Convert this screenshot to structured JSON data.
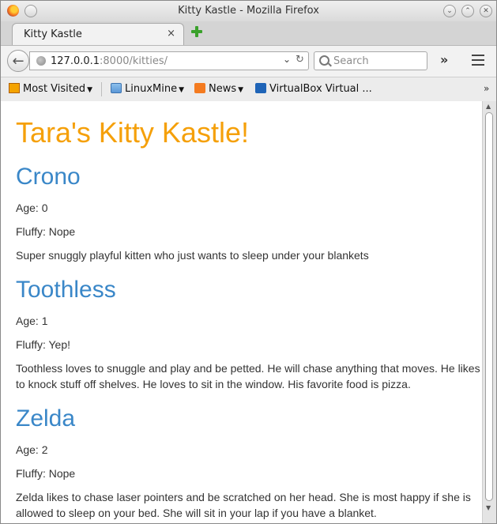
{
  "window": {
    "title": "Kitty Kastle - Mozilla Firefox"
  },
  "tab": {
    "label": "Kitty Kastle",
    "close_glyph": "×"
  },
  "navbar": {
    "url_host": "127.0.0.1",
    "url_rest": ":8000/kitties/",
    "search_placeholder": "Search",
    "overflow_glyph": "»"
  },
  "bookmarks": {
    "items": [
      {
        "label": "Most Visited",
        "icon": "most-visited-icon"
      },
      {
        "label": "LinuxMine",
        "icon": "folder-icon"
      },
      {
        "label": "News",
        "icon": "rss-icon"
      },
      {
        "label": "VirtualBox Virtual ...",
        "icon": "virtualbox-icon"
      }
    ],
    "more_glyph": "»"
  },
  "page": {
    "title": "Tara's Kitty Kastle!",
    "kitties": [
      {
        "name": "Crono",
        "age": "Age: 0",
        "fluffy": "Fluffy: Nope",
        "description": "Super snuggly playful kitten who just wants to sleep under your blankets"
      },
      {
        "name": "Toothless",
        "age": "Age: 1",
        "fluffy": "Fluffy: Yep!",
        "description": "Toothless loves to snuggle and play and be petted. He will chase anything that moves. He likes to knock stuff off shelves. He loves to sit in the window. His favorite food is pizza."
      },
      {
        "name": "Zelda",
        "age": "Age: 2",
        "fluffy": "Fluffy: Nope",
        "description": "Zelda likes to chase laser pointers and be scratched on her head. She is most happy if she is allowed to sleep on your bed. She will sit in your lap if you have a blanket."
      }
    ]
  },
  "colors": {
    "heading": "#f5a00a",
    "kitty_name": "#3a87c8"
  }
}
